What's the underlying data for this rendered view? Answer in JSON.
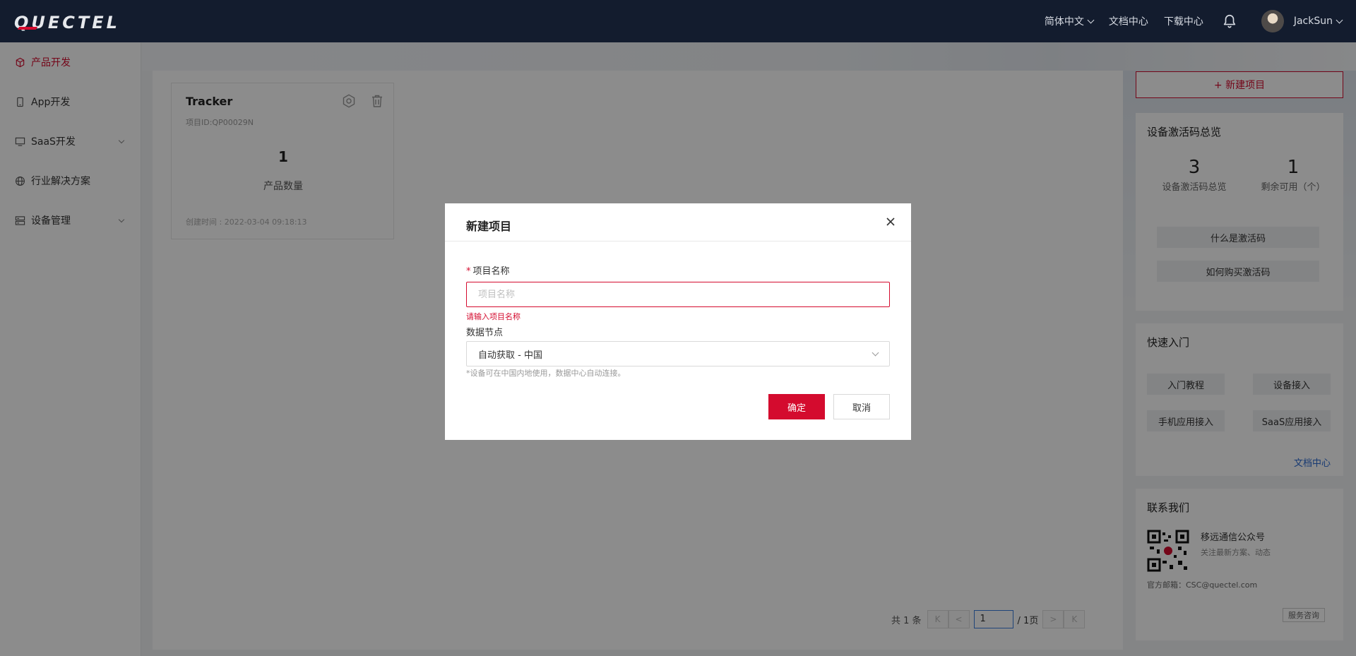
{
  "brand": {
    "logo_text": "QUECTEL",
    "accent": "#d40b2e"
  },
  "topnav": {
    "language": "简体中文",
    "docs": "文档中心",
    "downloads": "下载中心",
    "username": "JackSun"
  },
  "sidebar": {
    "items": [
      {
        "label": "产品开发",
        "icon": "cube-icon",
        "active": true
      },
      {
        "label": "App开发",
        "icon": "phone-icon"
      },
      {
        "label": "SaaS开发",
        "icon": "monitor-icon",
        "expandable": true
      },
      {
        "label": "行业解决方案",
        "icon": "globe-icon"
      },
      {
        "label": "设备管理",
        "icon": "server-icon",
        "expandable": true
      }
    ]
  },
  "project_card": {
    "title": "Tracker",
    "id_text": "项目ID:QP00029N",
    "count": "1",
    "count_label": "产品数量",
    "created": "创建时间 : 2022-03-04 09:18:13"
  },
  "pagination": {
    "total": "共 1 条",
    "current_page": "1",
    "total_pages": "/ 1页",
    "first": "K",
    "prev": "<",
    "next": ">",
    "last": "K"
  },
  "right_panel": {
    "new_project_label": "+ 新建项目",
    "activation": {
      "title": "设备激活码总览",
      "total_num": "3",
      "total_label": "设备激活码总览",
      "remain_num": "1",
      "remain_label": "剩余可用（个）",
      "what_label": "什么是激活码",
      "buy_label": "如何购买激活码"
    },
    "quick_start": {
      "title": "快速入门",
      "tutorial": "入门教程",
      "device_access": "设备接入",
      "mobile_access": "手机应用接入",
      "saas_access": "SaaS应用接入",
      "docs_link": "文档中心"
    },
    "contact": {
      "title": "联系我们",
      "name": "移远通信公众号",
      "subtitle": "关注最新方案、动态",
      "email": "官方邮箱：CSC@quectel.com",
      "service_label": "服务咨询"
    }
  },
  "modal": {
    "title": "新建项目",
    "name_label": "项目名称",
    "name_required_mark": "*",
    "name_value": "",
    "name_placeholder": "项目名称",
    "name_error": "请输入项目名称",
    "node_label": "数据节点",
    "node_value": "自动获取 - 中国",
    "node_hint": "*设备可在中国内地使用，数据中心自动连接。",
    "ok_label": "确定",
    "cancel_label": "取消"
  }
}
